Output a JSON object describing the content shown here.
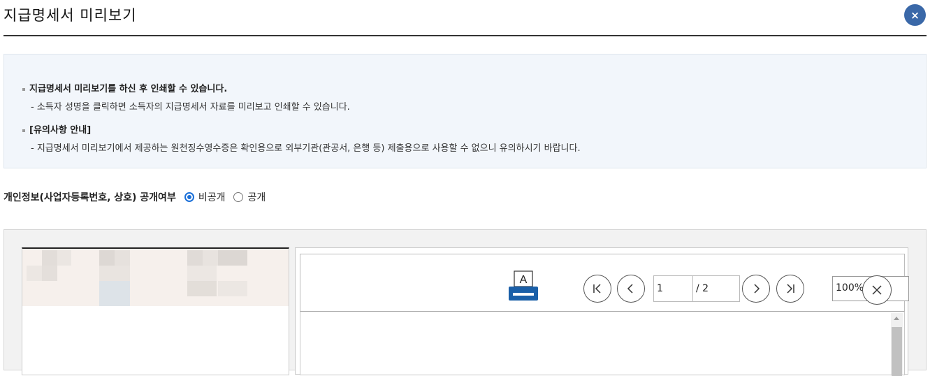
{
  "dialog": {
    "title": "지급명세서 미리보기",
    "close_label": "×"
  },
  "info": {
    "line1": "지급명세서 미리보기를 하신 후 인쇄할 수 있습니다.",
    "line2": "- 소득자 성명을 클릭하면 소득자의 지급명세서 자료를 미리보고 인쇄할 수 있습니다.",
    "line3": "[유의사항 안내]",
    "line4": "- 지급명세서 미리보기에서 제공하는 원천징수영수증은 확인용으로 외부기관(관공서, 은행 등) 제출용으로 사용할 수 없으니 유의하시기 바랍니다."
  },
  "privacy": {
    "label": "개인정보(사업자등록번호, 상호) 공개여부",
    "options": [
      {
        "label": "비공개",
        "selected": true
      },
      {
        "label": "공개",
        "selected": false
      }
    ]
  },
  "viewer": {
    "page_current": "1",
    "page_total": "/ 2",
    "zoom": "100%",
    "icons": [
      "print-icon",
      "first-page-icon",
      "prev-page-icon",
      "next-page-icon",
      "last-page-icon",
      "close-icon"
    ]
  },
  "colors": {
    "accent": "#3a68a8",
    "radio": "#1a6fd8",
    "info_bg": "#f2f6fb",
    "printer": "#1a5fa8"
  }
}
